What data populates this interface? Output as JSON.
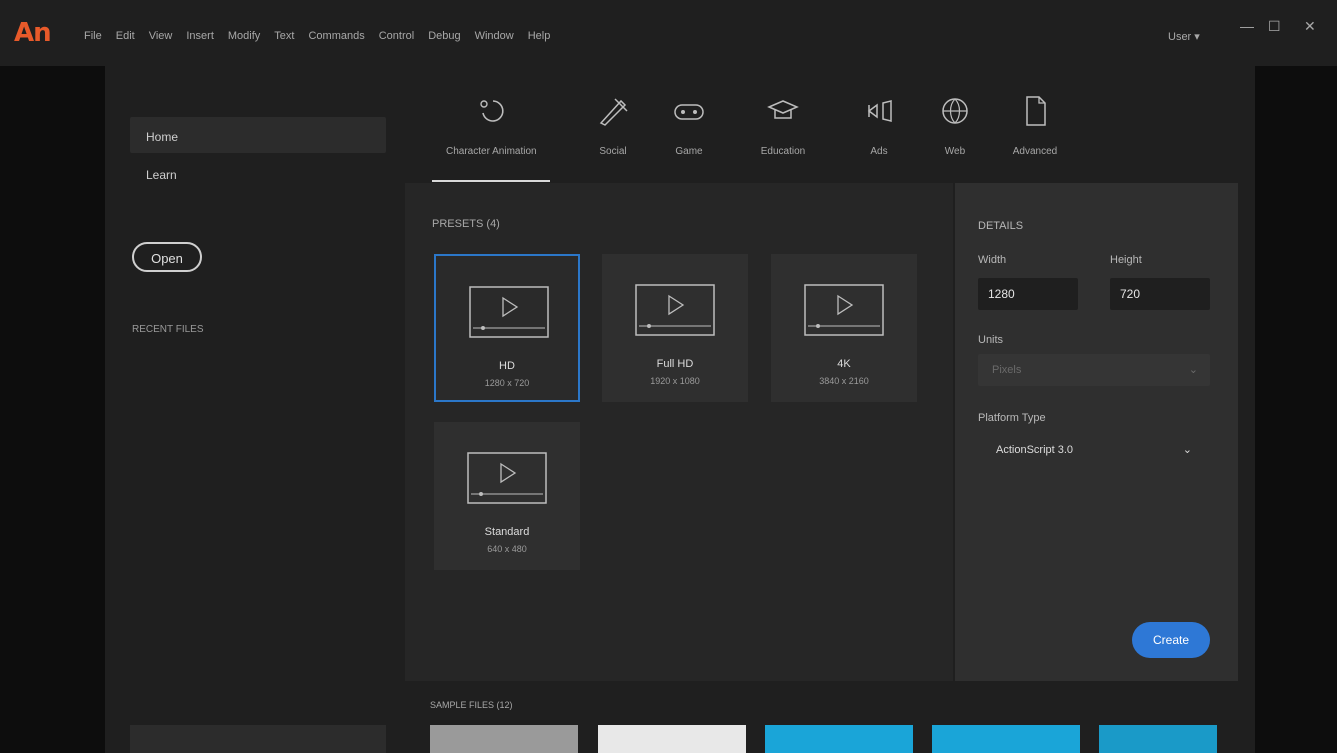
{
  "app": {
    "logo": "An",
    "menu": [
      "File",
      "Edit",
      "View",
      "Insert",
      "Modify",
      "Text",
      "Commands",
      "Control",
      "Debug",
      "Window",
      "Help"
    ],
    "user": "User",
    "window_controls": {
      "minimize": "—",
      "restore": "☐",
      "close": "✕"
    }
  },
  "nav": {
    "home": "Home",
    "learn": "Learn",
    "open_button": "Open",
    "recent_label": "RECENT FILES"
  },
  "tabs": [
    {
      "label": "Character Animation",
      "icon": "character-animation-icon"
    },
    {
      "label": "Social",
      "icon": "social-icon"
    },
    {
      "label": "Game",
      "icon": "game-icon"
    },
    {
      "label": "Education",
      "icon": "education-icon"
    },
    {
      "label": "Ads",
      "icon": "ads-icon"
    },
    {
      "label": "Web",
      "icon": "web-icon"
    },
    {
      "label": "Advanced",
      "icon": "advanced-icon"
    }
  ],
  "presets": {
    "title": "PRESETS (4)",
    "items": [
      {
        "name": "HD",
        "size": "1280 x 720",
        "selected": true
      },
      {
        "name": "Full HD",
        "size": "1920 x 1080",
        "selected": false
      },
      {
        "name": "4K",
        "size": "3840 x 2160",
        "selected": false
      },
      {
        "name": "Standard",
        "size": "640 x 480",
        "selected": false
      }
    ]
  },
  "details": {
    "title": "DETAILS",
    "width_label": "Width",
    "width_value": "1280",
    "height_label": "Height",
    "height_value": "720",
    "units_label": "Units",
    "units_value": "Pixels",
    "platform_label": "Platform Type",
    "platform_value": "ActionScript 3.0",
    "create_button": "Create"
  },
  "samples": {
    "title": "SAMPLE FILES (12)",
    "colors": [
      "#9a9a9a",
      "#e8e8e8",
      "#1aa5d8",
      "#1aa5d8",
      "#1a9ac8"
    ]
  },
  "colors": {
    "accent": "#2e78d6",
    "selected_border": "#2b77c9",
    "logo": "#e85a2a"
  }
}
